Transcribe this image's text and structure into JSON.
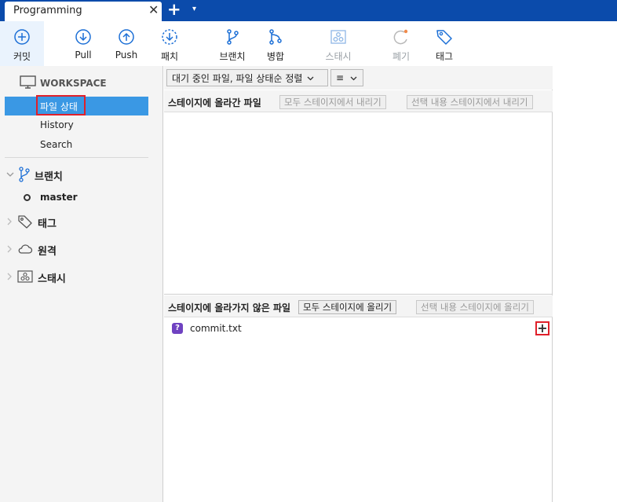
{
  "window": {
    "tab_title": "Programming",
    "close_glyph": "✕",
    "add_glyph": "+",
    "menu_glyph": "▾"
  },
  "toolbar": {
    "commit": "커밋",
    "pull": "Pull",
    "push": "Push",
    "patch": "패치",
    "branch": "브랜치",
    "merge": "병합",
    "stash": "스태시",
    "discard": "폐기",
    "tag": "태그"
  },
  "sidebar": {
    "workspace": "WORKSPACE",
    "items": [
      {
        "label": "파일 상태",
        "selected": true
      },
      {
        "label": "History",
        "selected": false
      },
      {
        "label": "Search",
        "selected": false
      }
    ],
    "groups": {
      "branches": "브랜치",
      "branch_current": "master",
      "tags": "태그",
      "remotes": "원격",
      "stashes": "스태시"
    }
  },
  "main": {
    "sort_dropdown": "대기 중인 파일, 파일 상태순 정렬",
    "view_dropdown": "≡",
    "staged": {
      "title": "스테이지에 올라간 파일",
      "unstage_all": "모두 스테이지에서 내리기",
      "unstage_selected": "선택 내용 스테이지에서 내리기"
    },
    "unstaged": {
      "title": "스테이지에 올라가지 않은 파일",
      "stage_all": "모두 스테이지에 올리기",
      "stage_selected": "선택 내용 스테이지에 올리기",
      "files": [
        {
          "name": "commit.txt",
          "status_glyph": "?"
        }
      ],
      "stage_glyph": "+"
    }
  },
  "colors": {
    "titlebar": "#0b4bab",
    "selection": "#3a98e4",
    "highlight": "#e0202a",
    "accent": "#1c6fd6"
  }
}
